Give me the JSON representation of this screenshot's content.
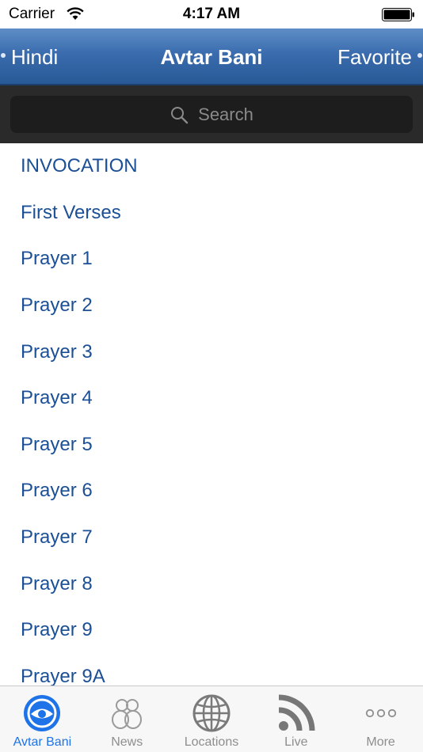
{
  "status": {
    "carrier": "Carrier",
    "time": "4:17 AM"
  },
  "nav": {
    "left": "Hindi",
    "title": "Avtar Bani",
    "right": "Favorite"
  },
  "search": {
    "placeholder": "Search"
  },
  "list": {
    "items": [
      "INVOCATION",
      "First Verses",
      "Prayer 1",
      "Prayer 2",
      "Prayer 3",
      "Prayer 4",
      "Prayer 5",
      "Prayer 6",
      "Prayer 7",
      "Prayer 8",
      "Prayer 9",
      "Prayer 9A"
    ]
  },
  "tabs": [
    {
      "label": "Avtar Bani",
      "icon": "avtar-bani-icon",
      "active": true
    },
    {
      "label": "News",
      "icon": "people-icon",
      "active": false
    },
    {
      "label": "Locations",
      "icon": "globe-icon",
      "active": false
    },
    {
      "label": "Live",
      "icon": "rss-icon",
      "active": false
    },
    {
      "label": "More",
      "icon": "more-icon",
      "active": false
    }
  ],
  "colors": {
    "nav_top": "#5f8ec6",
    "nav_bottom": "#285996",
    "list_text": "#1b4f96",
    "tab_active": "#1e73e8",
    "tab_inactive": "#8e8e8e"
  }
}
